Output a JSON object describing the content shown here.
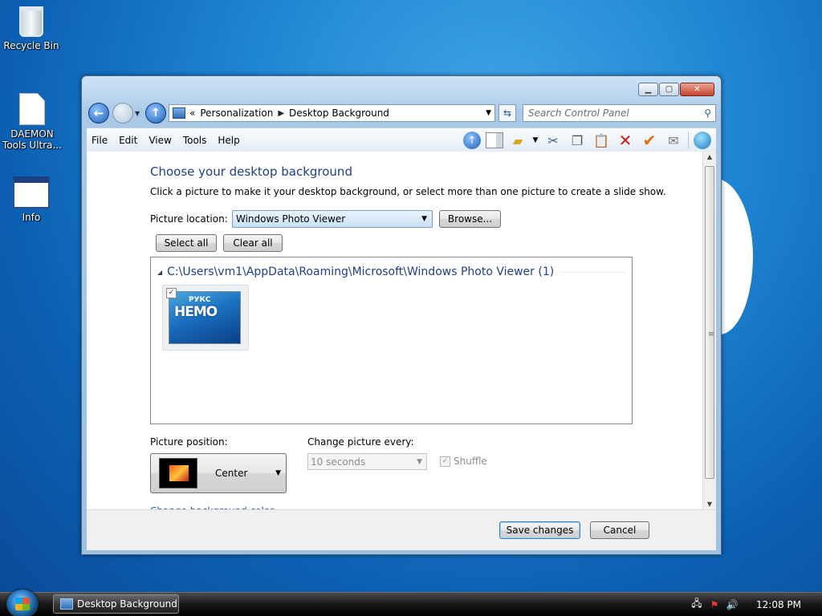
{
  "desktop": {
    "icons": [
      {
        "label": "Recycle Bin"
      },
      {
        "label": "DAEMON Tools Ultra..."
      },
      {
        "label": "Info"
      }
    ]
  },
  "window": {
    "address": {
      "chevrons": "«",
      "crumbs": [
        "Personalization",
        "Desktop Background"
      ]
    },
    "search": {
      "placeholder": "Search Control Panel"
    },
    "menu": [
      "File",
      "Edit",
      "View",
      "Tools",
      "Help"
    ],
    "toolbar_icons": [
      "up-icon",
      "layout-icon",
      "folder-check-icon",
      "cut-icon",
      "copy-icon",
      "paste-icon",
      "delete-icon",
      "check-icon",
      "email-icon",
      "globe-icon"
    ],
    "content": {
      "title": "Choose your desktop background",
      "subtitle": "Click a picture to make it your desktop background, or select more than one picture to create a slide show.",
      "picture_location_label": "Picture location:",
      "picture_location_value": "Windows Photo Viewer",
      "browse_label": "Browse...",
      "select_all_label": "Select all",
      "clear_all_label": "Clear all",
      "group_path": "C:\\Users\\vm1\\AppData\\Roaming\\Microsoft\\Windows Photo Viewer (1)",
      "thumbnail": {
        "checked": true,
        "logo_small": "РУКС",
        "logo_big": "НЕМО"
      },
      "picture_position_label": "Picture position:",
      "picture_position_value": "Center",
      "change_every_label": "Change picture every:",
      "change_every_value": "10 seconds",
      "shuffle_label": "Shuffle",
      "change_color_link": "Change background color"
    },
    "footer": {
      "save_label": "Save changes",
      "cancel_label": "Cancel"
    }
  },
  "taskbar": {
    "task_label": "Desktop Background",
    "clock": "12:08 PM"
  },
  "colors": {
    "title_blue": "#1e3f8a",
    "link_blue": "#2a5aa8"
  }
}
